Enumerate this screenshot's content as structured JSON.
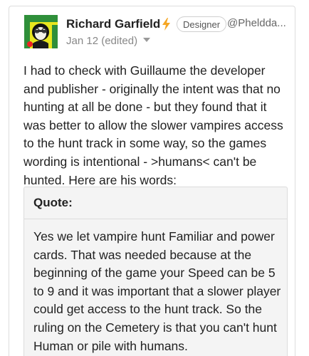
{
  "post": {
    "author": "Richard Garfield",
    "badge": "Designer",
    "handle": "@Phelddа...",
    "date": "Jan 12 (edited)",
    "body": "I had to check with Guillaume the developer and publisher - originally the intent was that no hunting at all be done - but they found that it was better to allow the slower vampires access to the hunt track in some way, so the games wording is intentional - >humans< can't be hunted. Here are his words:",
    "quote": {
      "title": "Quote:",
      "text": "Yes we let vampire hunt Familiar and power cards. That was needed because at the beginning of the game your Speed can be 5 to 9 and it was important that a slower player could get access to the hunt track. So the ruling on the Cemetery is that you can't hunt Human or pile with humans."
    }
  },
  "colors": {
    "accent_bolt": "#f5a623",
    "avatar_background": "#e8e61f"
  },
  "icons": [
    "avatar",
    "bolt-icon",
    "chevron-down-icon"
  ]
}
